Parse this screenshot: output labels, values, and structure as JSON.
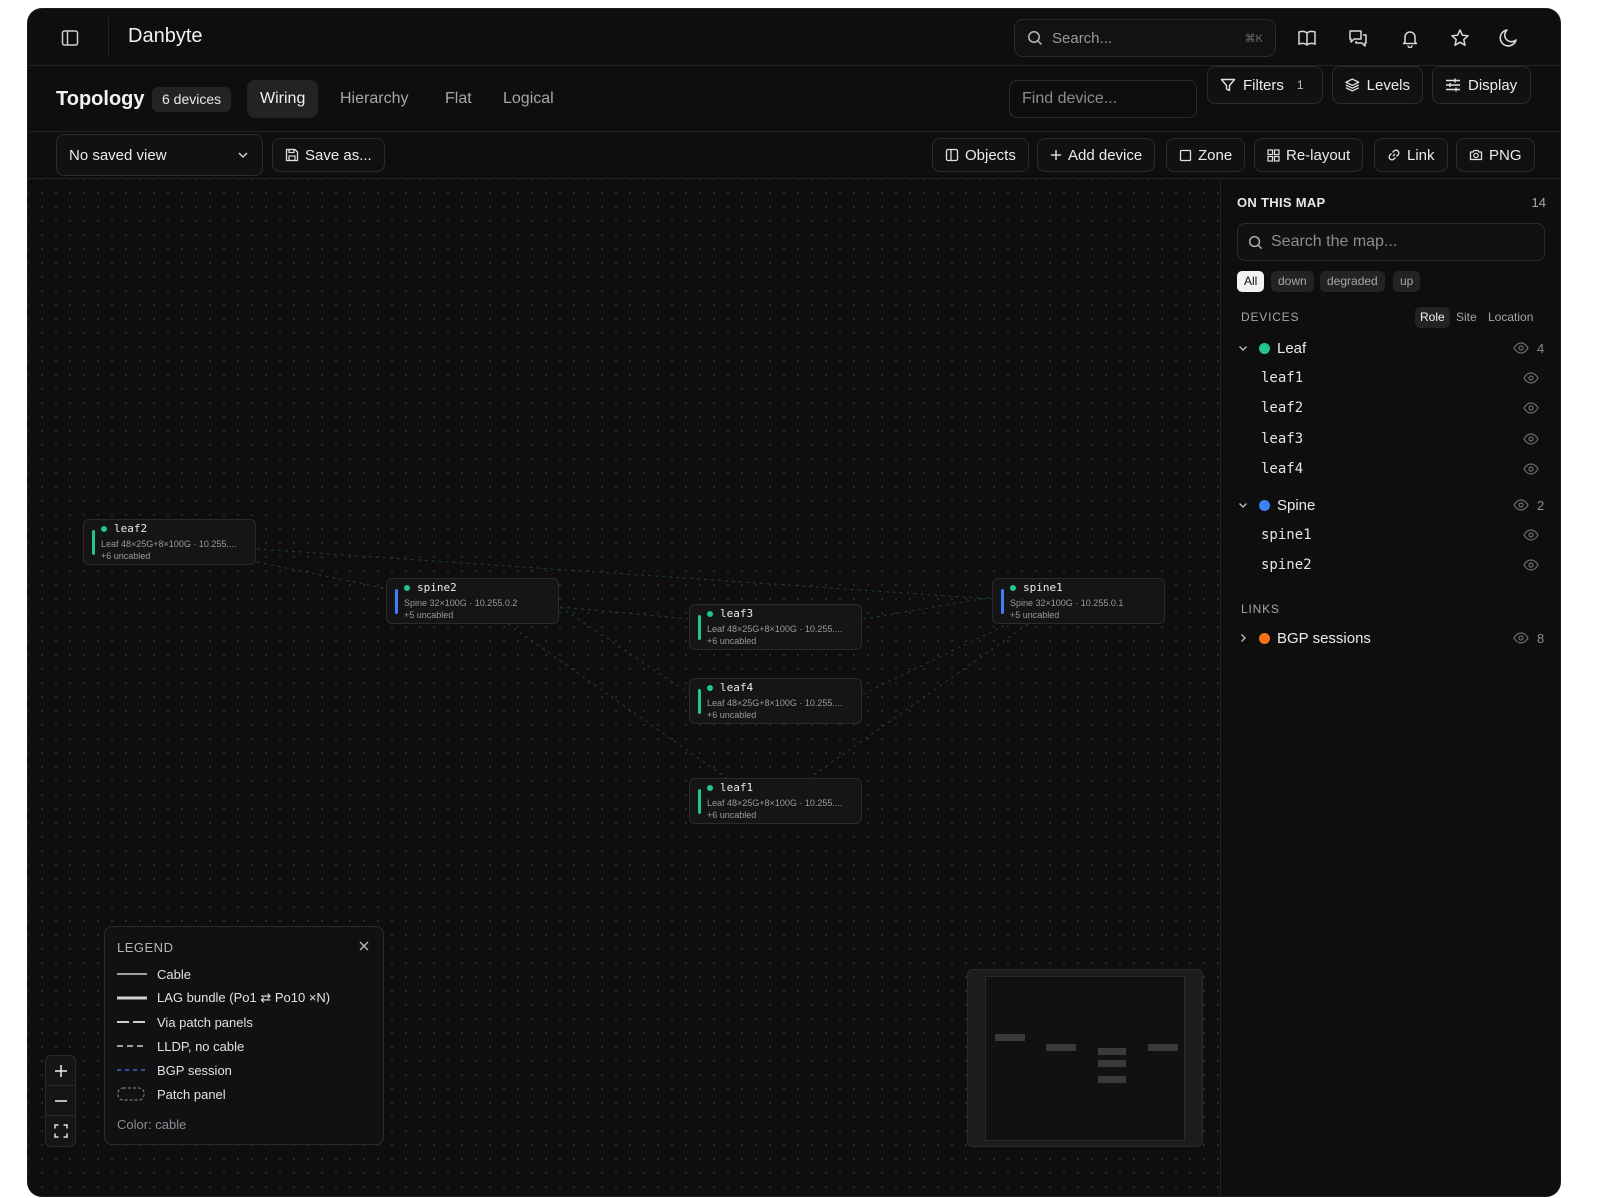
{
  "app": {
    "title": "Danbyte"
  },
  "search": {
    "placeholder": "Search...",
    "shortcut": "⌘K"
  },
  "header_icons": [
    "book-icon",
    "chat-icon",
    "bell-icon",
    "star-icon",
    "moon-icon"
  ],
  "topology": {
    "title": "Topology",
    "device_count": "6 devices",
    "tabs": [
      {
        "label": "Wiring",
        "active": true
      },
      {
        "label": "Hierarchy",
        "active": false
      },
      {
        "label": "Flat",
        "active": false
      },
      {
        "label": "Logical",
        "active": false
      }
    ],
    "find_placeholder": "Find device...",
    "filters_label": "Filters",
    "filters_count": "1",
    "levels_label": "Levels",
    "display_label": "Display"
  },
  "toolbar": {
    "saved_view": "No saved view",
    "save_as": "Save as...",
    "objects": "Objects",
    "add_device": "Add device",
    "zone": "Zone",
    "relayout": "Re-layout",
    "link": "Link",
    "png": "PNG"
  },
  "nodes": [
    {
      "id": "leaf2",
      "name": "leaf2",
      "meta": "Leaf 48×25G+8×100G · 10.255....",
      "uncabled": "+6 uncabled",
      "role": "leaf"
    },
    {
      "id": "spine2",
      "name": "spine2",
      "meta": "Spine 32×100G · 10.255.0.2",
      "uncabled": "+5 uncabled",
      "role": "spine"
    },
    {
      "id": "leaf3",
      "name": "leaf3",
      "meta": "Leaf 48×25G+8×100G · 10.255....",
      "uncabled": "+6 uncabled",
      "role": "leaf"
    },
    {
      "id": "leaf4",
      "name": "leaf4",
      "meta": "Leaf 48×25G+8×100G · 10.255....",
      "uncabled": "+6 uncabled",
      "role": "leaf"
    },
    {
      "id": "leaf1",
      "name": "leaf1",
      "meta": "Leaf 48×25G+8×100G · 10.255....",
      "uncabled": "+6 uncabled",
      "role": "leaf"
    },
    {
      "id": "spine1",
      "name": "spine1",
      "meta": "Spine 32×100G · 10.255.0.1",
      "uncabled": "+5 uncabled",
      "role": "spine"
    }
  ],
  "legend": {
    "title": "LEGEND",
    "items": [
      {
        "label": "Cable",
        "style": "solid"
      },
      {
        "label": "LAG bundle (Po1 ⇄ Po10 ×N)",
        "style": "double"
      },
      {
        "label": "Via patch panels",
        "style": "long-dash"
      },
      {
        "label": "LLDP, no cable",
        "style": "dash"
      },
      {
        "label": "BGP session",
        "style": "blue-dash"
      },
      {
        "label": "Patch panel",
        "style": "box"
      }
    ],
    "footer": "Color: cable"
  },
  "panel": {
    "title": "ON THIS MAP",
    "count": "14",
    "search_placeholder": "Search the map...",
    "status_chips": [
      {
        "label": "All",
        "active": true
      },
      {
        "label": "down",
        "active": false
      },
      {
        "label": "degraded",
        "active": false
      },
      {
        "label": "up",
        "active": false
      }
    ],
    "devices_header": "DEVICES",
    "group_tabs": [
      {
        "label": "Role",
        "active": true
      },
      {
        "label": "Site",
        "active": false
      },
      {
        "label": "Location",
        "active": false
      }
    ],
    "groups": [
      {
        "name": "Leaf",
        "count": "4",
        "color": "#22c58b",
        "expanded": true,
        "items": [
          "leaf1",
          "leaf2",
          "leaf3",
          "leaf4"
        ]
      },
      {
        "name": "Spine",
        "count": "2",
        "color": "#3b82f6",
        "expanded": true,
        "items": [
          "spine1",
          "spine2"
        ]
      }
    ],
    "links_header": "LINKS",
    "links": [
      {
        "name": "BGP sessions",
        "count": "8",
        "color": "#f97316",
        "expanded": false
      }
    ]
  },
  "colors": {
    "leaf": "#22c58b",
    "spine": "#3b82f6",
    "bgp": "#f97316"
  }
}
